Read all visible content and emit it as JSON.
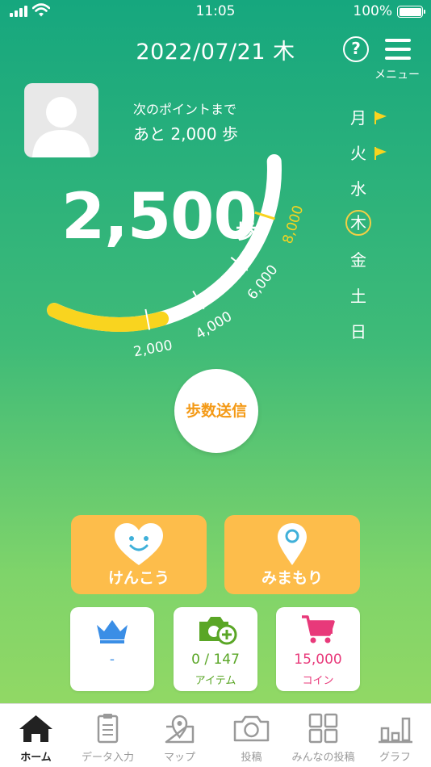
{
  "status_bar": {
    "time": "11:05",
    "battery": "100%"
  },
  "header": {
    "date": "2022/07/21 木",
    "help_label": "?",
    "menu_label": "メニュー"
  },
  "goal": {
    "line1": "次のポイントまで",
    "line2": "あと 2,000 歩"
  },
  "steps": {
    "value": "2,500",
    "unit": "歩",
    "progress_steps": 2500
  },
  "gauge": {
    "ticks": [
      "2,000",
      "4,000",
      "6,000",
      "8,000"
    ]
  },
  "weekdays": [
    {
      "label": "月",
      "flag": true,
      "current": false
    },
    {
      "label": "火",
      "flag": true,
      "current": false
    },
    {
      "label": "水",
      "flag": false,
      "current": false
    },
    {
      "label": "木",
      "flag": false,
      "current": true
    },
    {
      "label": "金",
      "flag": false,
      "current": false
    },
    {
      "label": "土",
      "flag": false,
      "current": false
    },
    {
      "label": "日",
      "flag": false,
      "current": false
    }
  ],
  "send_button": "歩数送信",
  "tiles": {
    "health": "けんこう",
    "watch": "みまもり",
    "rank": {
      "value": "-",
      "icon": "crown-icon"
    },
    "items": {
      "value": "0 / 147",
      "sub": "アイテム",
      "icon": "camera-plus-icon"
    },
    "coins": {
      "value": "15,000",
      "sub": "コイン",
      "icon": "cart-icon"
    }
  },
  "tabs": [
    {
      "label": "ホーム",
      "icon": "home-icon",
      "active": true
    },
    {
      "label": "データ入力",
      "icon": "clipboard-icon",
      "active": false
    },
    {
      "label": "マップ",
      "icon": "map-icon",
      "active": false
    },
    {
      "label": "投稿",
      "icon": "camera-icon",
      "active": false
    },
    {
      "label": "みんなの投稿",
      "icon": "grid-icon",
      "active": false
    },
    {
      "label": "グラフ",
      "icon": "bar-chart-icon",
      "active": false
    }
  ],
  "colors": {
    "accent_yellow": "#f9d41f",
    "accent_orange": "#f49a17",
    "tile_orange": "#fdbd4b",
    "rank_blue": "#3a8ee6",
    "item_green": "#5aa626",
    "coin_pink": "#e8397a"
  }
}
